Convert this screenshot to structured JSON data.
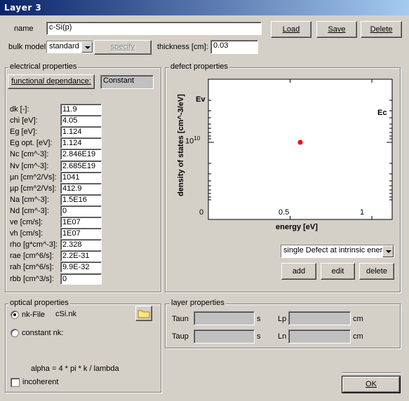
{
  "window": {
    "title": "Layer 3"
  },
  "header": {
    "name_label": "name",
    "name_value": "c-Si(p)",
    "bulk_model_label": "bulk model",
    "bulk_model_value": "standard",
    "specify_label": "specify",
    "thickness_label": "thickness [cm]:",
    "thickness_value": "0.03",
    "load_label": "Load",
    "save_label": "Save",
    "delete_label": "Delete"
  },
  "electrical": {
    "title": "electrical properties",
    "functional_button": "functional dependance:",
    "functional_value": "Constant",
    "params": [
      {
        "label": "dk [-]:",
        "value": "11.9"
      },
      {
        "label": "chi [eV]:",
        "value": "4.05"
      },
      {
        "label": "Eg [eV]:",
        "value": "1.124"
      },
      {
        "label": "Eg opt. [eV]:",
        "value": "1.124"
      },
      {
        "label": "Nc [cm^-3]:",
        "value": "2.846E19"
      },
      {
        "label": "Nv [cm^-3]:",
        "value": "2.685E19"
      },
      {
        "label": "µn [cm^2/Vs]:",
        "value": "1041"
      },
      {
        "label": "µp [cm^2/Vs]:",
        "value": "412.9"
      },
      {
        "label": "Na [cm^-3]:",
        "value": "1.5E16"
      },
      {
        "label": "Nd [cm^-3]:",
        "value": "0"
      },
      {
        "label": "ve [cm/s]:",
        "value": "1E07"
      },
      {
        "label": "vh [cm/s]:",
        "value": "1E07"
      },
      {
        "label": "rho [g*cm^-3]:",
        "value": "2.328"
      },
      {
        "label": "rae [cm^6/s]:",
        "value": "2.2E-31"
      },
      {
        "label": "rah [cm^6/s]:",
        "value": "9.9E-32"
      },
      {
        "label": "rbb [cm^3/s]:",
        "value": "0"
      }
    ]
  },
  "defect": {
    "title": "defect properties",
    "ylabel": "density of states [cm^-3/eV]",
    "xlabel": "energy [eV]",
    "ev_label": "Ev",
    "ec_label": "Ec",
    "ytick_base": "10",
    "ytick_exp": "10",
    "xticks": [
      "0",
      "0.5",
      "1"
    ],
    "defect_type": "single Defect at intrinsic energy",
    "add_label": "add",
    "edit_label": "edit",
    "delete_label": "delete",
    "point_color": "#ff0000"
  },
  "chart_data": {
    "type": "scatter",
    "xlabel": "energy [eV]",
    "ylabel": "density of states [cm^-3/eV]",
    "xlim": [
      0,
      1.124
    ],
    "yscale": "log",
    "points": [
      {
        "x": 0.562,
        "y": 10000000000.0
      }
    ],
    "annotations": [
      "Ev",
      "Ec"
    ]
  },
  "optical": {
    "title": "optical properties",
    "nk_file_label": "nk-File",
    "nk_file_value": "cSi.nk",
    "constant_nk_label": "constant nk:",
    "formula": "alpha = 4 * pi * k / lambda",
    "incoherent_label": "incoherent",
    "folder_icon": "folder-icon"
  },
  "layer": {
    "title": "layer properties",
    "taun_label": "Taun",
    "taup_label": "Taup",
    "lp_label": "Lp",
    "ln_label": "Ln",
    "s_unit": "s",
    "cm_unit": "cm"
  },
  "footer": {
    "ok_label": "OK"
  }
}
